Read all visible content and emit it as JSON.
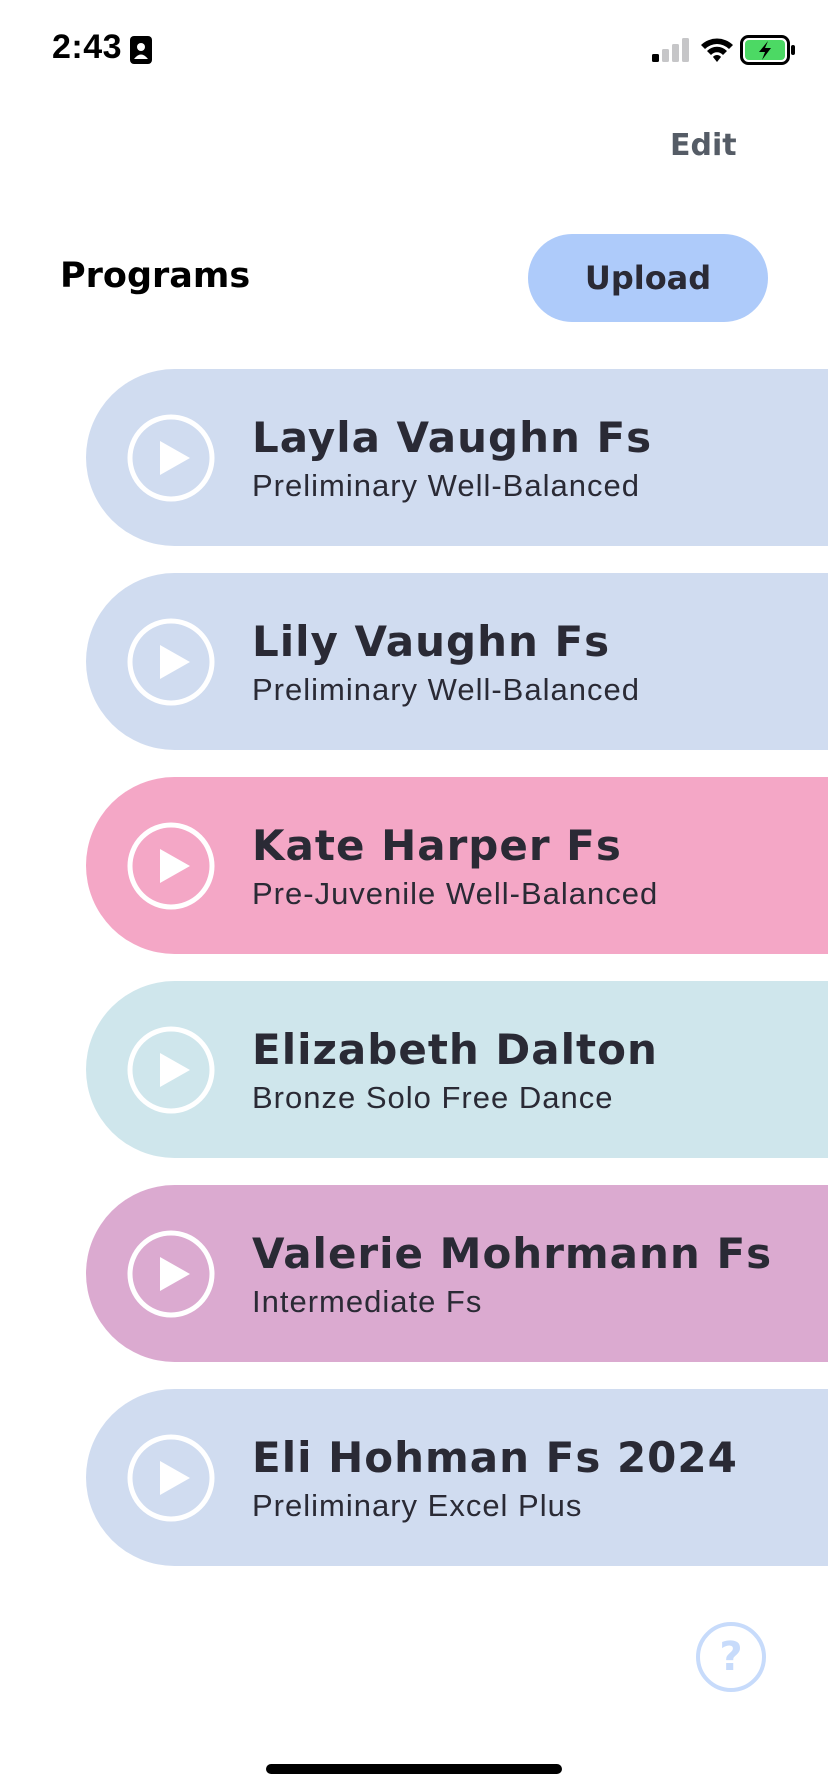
{
  "status_bar": {
    "time": "2:43",
    "icons": [
      "person-badge-icon",
      "cellular-signal-icon",
      "wifi-icon",
      "battery-charging-icon"
    ]
  },
  "header": {
    "edit_label": "Edit"
  },
  "section": {
    "title": "Programs",
    "upload_label": "Upload"
  },
  "programs": [
    {
      "name": "Layla Vaughn Fs",
      "subtitle": "Preliminary Well-Balanced",
      "color": "#d0dcf0"
    },
    {
      "name": "Lily Vaughn Fs",
      "subtitle": "Preliminary Well-Balanced",
      "color": "#d0dcf0"
    },
    {
      "name": "Kate Harper Fs",
      "subtitle": "Pre-Juvenile Well-Balanced",
      "color": "#f4a7c6"
    },
    {
      "name": "Elizabeth Dalton",
      "subtitle": "Bronze Solo Free Dance",
      "color": "#cfe6ec"
    },
    {
      "name": "Valerie Mohrmann Fs",
      "subtitle": "Intermediate Fs",
      "color": "#dbaad0"
    },
    {
      "name": "Eli Hohman Fs 2024",
      "subtitle": "Preliminary Excel Plus",
      "color": "#d0dcf0"
    }
  ],
  "help": {
    "label": "?",
    "icon": "help-circle-icon"
  },
  "colors": {
    "accent": "#aecbfa",
    "battery": "#4cd964",
    "help": "#c7dbfb"
  }
}
